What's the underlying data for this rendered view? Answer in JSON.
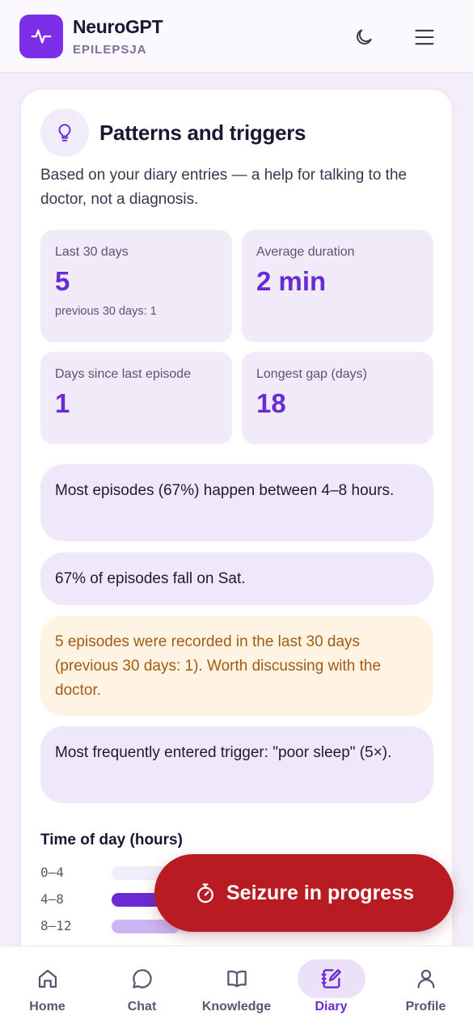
{
  "app": {
    "name": "NeuroGPT",
    "subtitle": "EPILEPSJA"
  },
  "header": {
    "theme_icon": "moon-icon",
    "menu_icon": "hamburger-icon"
  },
  "card": {
    "title": "Patterns and triggers",
    "description": "Based on your diary entries — a help for talking to the doctor, not a diagnosis.",
    "stats": [
      {
        "label": "Last 30 days",
        "value": "5",
        "note": "previous 30 days: 1"
      },
      {
        "label": "Average duration",
        "value": "2 min"
      },
      {
        "label": "Days since last episode",
        "value": "1"
      },
      {
        "label": "Longest gap (days)",
        "value": "18"
      }
    ],
    "insights": [
      {
        "text": "Most episodes (67%) happen between 4–8 hours."
      },
      {
        "text": "67% of episodes fall on Sat."
      },
      {
        "text": "5 episodes were recorded in the last 30 days (previous 30 days: 1). Worth discussing with the doctor.",
        "tone": "warning"
      },
      {
        "text": "Most frequently entered trigger: \"poor sleep\" (5×)."
      }
    ],
    "time_of_day": {
      "title": "Time of day (hours)",
      "rows": [
        {
          "label": "0–4",
          "fraction": 0.0
        },
        {
          "label": "4–8",
          "fraction": 1.0
        },
        {
          "label": "8–12",
          "fraction": 0.5
        }
      ]
    }
  },
  "sos_button": {
    "label": "Seizure in progress",
    "icon": "stopwatch-icon"
  },
  "nav": {
    "items": [
      {
        "label": "Home",
        "icon": "home-icon",
        "active": false
      },
      {
        "label": "Chat",
        "icon": "chat-bubble-icon",
        "active": false
      },
      {
        "label": "Knowledge",
        "icon": "book-icon",
        "active": false
      },
      {
        "label": "Diary",
        "icon": "notebook-pen-icon",
        "active": true
      },
      {
        "label": "Profile",
        "icon": "user-icon",
        "active": false
      }
    ]
  },
  "colors": {
    "accent": "#6b2bd4",
    "logo_bg": "#7c2ee8",
    "sos": "#b81c22",
    "warning_text": "#a35a10",
    "warning_bg": "#fff4e3"
  }
}
